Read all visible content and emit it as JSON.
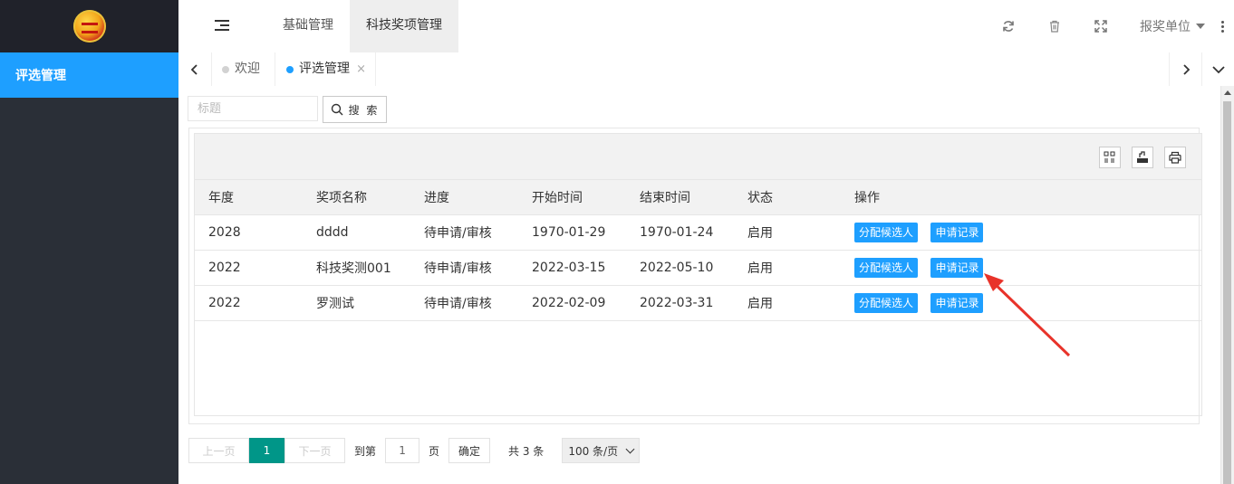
{
  "sidebar": {
    "items": [
      {
        "label": "评选管理"
      }
    ]
  },
  "header": {
    "nav": [
      {
        "label": "基础管理"
      },
      {
        "label": "科技奖项管理"
      }
    ],
    "unit_label": "报奖单位"
  },
  "tabs": [
    {
      "label": "欢迎",
      "active": false
    },
    {
      "label": "评选管理",
      "active": true,
      "close": "×"
    }
  ],
  "search": {
    "placeholder": "标题",
    "button_label": "搜 索"
  },
  "table": {
    "columns": [
      "年度",
      "奖项名称",
      "进度",
      "开始时间",
      "结束时间",
      "状态",
      "操作"
    ],
    "rows": [
      {
        "year": "2028",
        "name": "dddd",
        "progress": "待申请/审核",
        "start": "1970-01-29",
        "end": "1970-01-24",
        "status": "启用",
        "action1": "分配候选人",
        "action2": "申请记录"
      },
      {
        "year": "2022",
        "name": "科技奖测001",
        "progress": "待申请/审核",
        "start": "2022-03-15",
        "end": "2022-05-10",
        "status": "启用",
        "action1": "分配候选人",
        "action2": "申请记录"
      },
      {
        "year": "2022",
        "name": "罗测试",
        "progress": "待申请/审核",
        "start": "2022-02-09",
        "end": "2022-03-31",
        "status": "启用",
        "action1": "分配候选人",
        "action2": "申请记录"
      }
    ]
  },
  "pager": {
    "prev": "上一页",
    "current": "1",
    "next": "下一页",
    "goto_prefix": "到第",
    "goto_value": "1",
    "goto_suffix": "页",
    "confirm": "确定",
    "total": "共 3 条",
    "limit": "100 条/页"
  },
  "colors": {
    "accent": "#1e9fff",
    "sidebar_bg": "#2a2f37",
    "pager_active": "#009688",
    "annotation": "#e8332a"
  }
}
